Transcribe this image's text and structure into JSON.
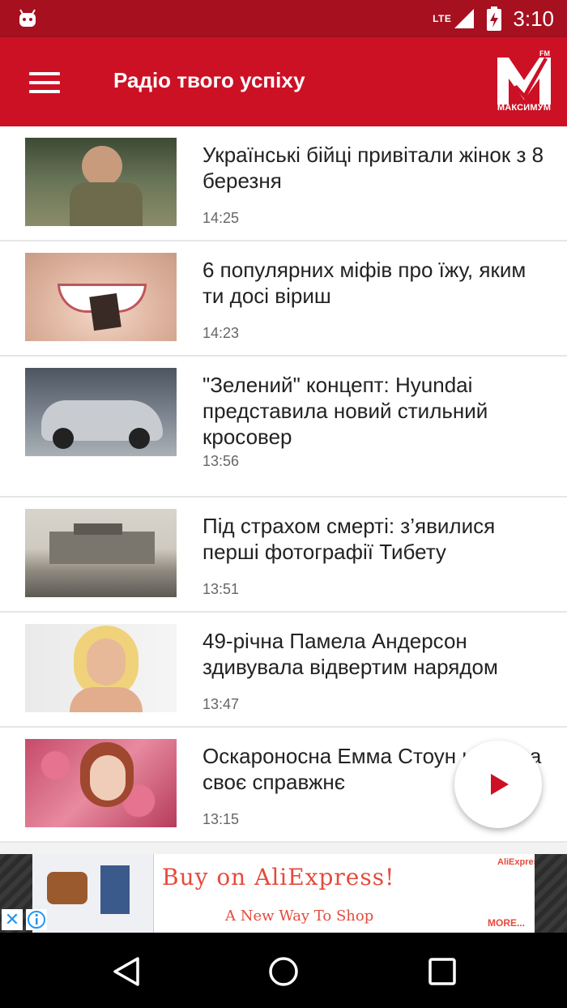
{
  "status_bar": {
    "time": "3:10",
    "network": "LTE",
    "icons": [
      "android-icon",
      "signal-icon",
      "battery-charging-icon"
    ]
  },
  "app_bar": {
    "title": "Радіо твого успіху",
    "logo_text": "МАКСИМУМ",
    "logo_fm": "FM",
    "accent_color": "#cc1125"
  },
  "feed": {
    "items": [
      {
        "title": "Українські бійці привітали жінок з 8 березня",
        "time": "14:25",
        "thumb": "soldier-photo"
      },
      {
        "title": "6 популярних міфів про їжу, яким ти досі віриш",
        "time": "14:23",
        "thumb": "smile-chocolate-photo"
      },
      {
        "title": "\"Зелений\" концепт: Hyundai представила новий стильний кросовер",
        "time": "13:56",
        "thumb": "hyundai-car-photo"
      },
      {
        "title": "Під страхом смерті: з’явилися перші фотографії Тибету",
        "time": "13:51",
        "thumb": "tibet-palace-photo"
      },
      {
        "title": "49-річна Памела Андерсон здивувала відвертим нарядом",
        "time": "13:47",
        "thumb": "pamela-anderson-photo"
      },
      {
        "title": "Оскароносна Емма Стоун назвала своє справжнє",
        "time": "13:15",
        "thumb": "emma-stone-photo"
      }
    ]
  },
  "ad": {
    "headline": "Buy on AliExpress!",
    "subline": "A New Way To Shop",
    "brand": "AliExpress",
    "more": "MORE...",
    "close": "✕",
    "info": "i"
  }
}
